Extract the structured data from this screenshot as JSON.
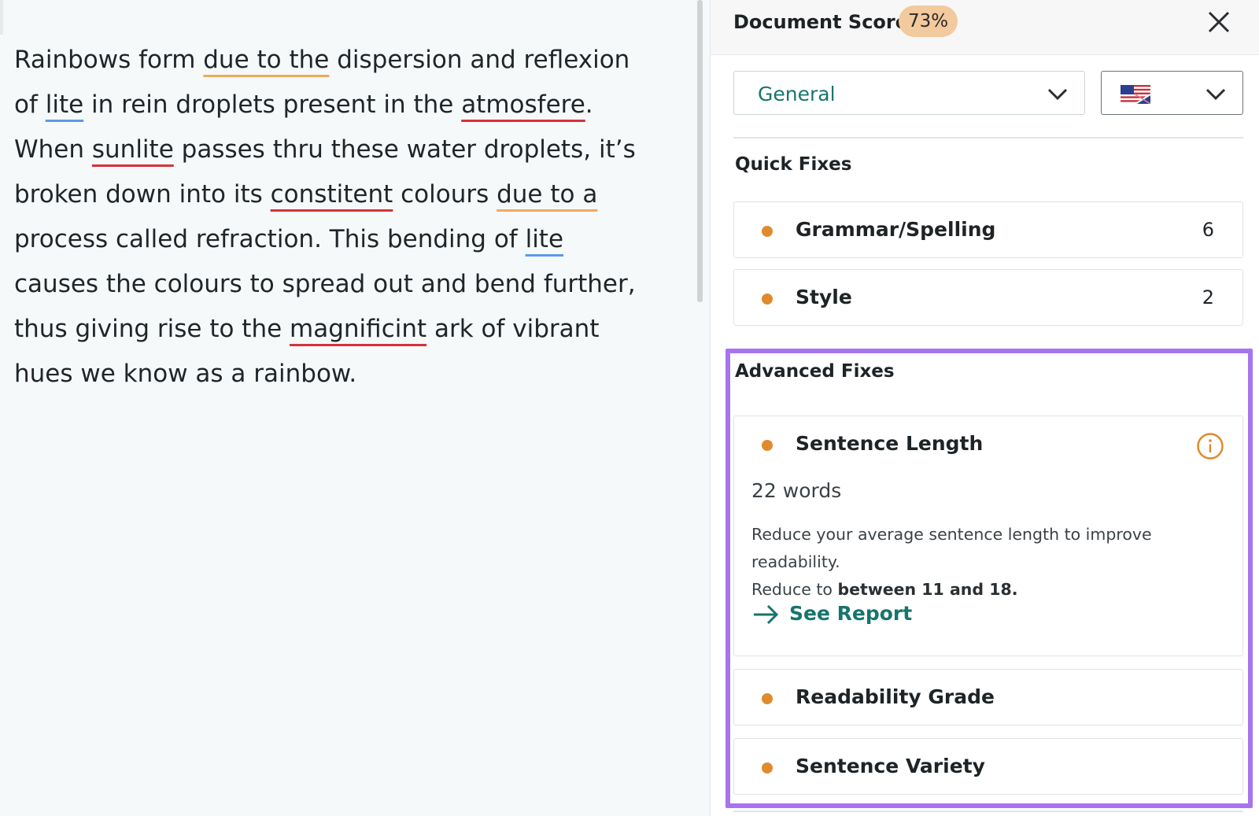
{
  "editor": {
    "segments": [
      {
        "text": "Rainbows form ",
        "mark": ""
      },
      {
        "text": "due to the",
        "mark": "orange"
      },
      {
        "text": " dispersion and reflexion of ",
        "mark": ""
      },
      {
        "text": "lite",
        "mark": "blue"
      },
      {
        "text": " in rein droplets present in the ",
        "mark": ""
      },
      {
        "text": "atmosfere",
        "mark": "red"
      },
      {
        "text": ". When ",
        "mark": ""
      },
      {
        "text": "sunlite",
        "mark": "red"
      },
      {
        "text": " passes thru these water droplets, it’s broken down into its ",
        "mark": ""
      },
      {
        "text": "constitent",
        "mark": "red"
      },
      {
        "text": " colours ",
        "mark": ""
      },
      {
        "text": "due to a",
        "mark": "orange"
      },
      {
        "text": " process called refraction. This bending of ",
        "mark": ""
      },
      {
        "text": "lite",
        "mark": "blue"
      },
      {
        "text": " causes the colours to spread out and bend further, thus giving rise to the ",
        "mark": ""
      },
      {
        "text": "magnificint",
        "mark": "red"
      },
      {
        "text": " ark of vibrant hues we know as a rainbow.",
        "mark": ""
      }
    ]
  },
  "panel": {
    "title": "Document Score",
    "score": "73%",
    "close_icon": "close-icon",
    "goal_select": {
      "value": "General"
    },
    "language_select": {
      "flag_icon": "us-flag-icon"
    },
    "quick_fixes": {
      "title": "Quick Fixes",
      "items": [
        {
          "label": "Grammar/Spelling",
          "count": "6"
        },
        {
          "label": "Style",
          "count": "2"
        }
      ]
    },
    "advanced_fixes": {
      "title": "Advanced Fixes",
      "sentence_length": {
        "label": "Sentence Length",
        "words": "22 words",
        "desc_line1": "Reduce your average sentence length to improve readability.",
        "desc_prefix": "Reduce to ",
        "desc_bold": "between 11 and 18.",
        "report_link": "See Report"
      },
      "items": [
        {
          "label": "Readability Grade"
        },
        {
          "label": "Sentence Variety"
        }
      ]
    }
  },
  "colors": {
    "accent_teal": "#16756d",
    "dot_orange": "#e08a2e",
    "highlight_purple": "#a774ee",
    "score_badge": "#f3c99e",
    "underline_red": "#d8313b",
    "underline_blue": "#5b9ae8",
    "underline_orange": "#f0a95f"
  }
}
